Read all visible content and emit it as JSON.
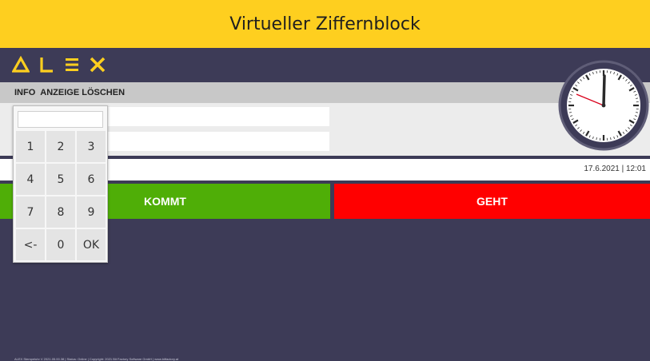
{
  "window": {
    "title": "Virtueller Ziffernblock"
  },
  "brand": {
    "logo_text": "ALEX",
    "logo_color": "#fecf1f"
  },
  "menu": {
    "items": [
      {
        "label": "INFO"
      },
      {
        "label": "ANZEIGE LÖSCHEN"
      }
    ]
  },
  "status": {
    "datetime": "17.6.2021 | 12:01"
  },
  "actions": {
    "kommt_label": "KOMMT",
    "geht_label": "GEHT",
    "kommt_color": "#4fae07",
    "geht_color": "#ff0000"
  },
  "numpad": {
    "display_value": "",
    "keys": [
      "1",
      "2",
      "3",
      "4",
      "5",
      "6",
      "7",
      "8",
      "9",
      "<-",
      "0",
      "OK"
    ]
  },
  "clock": {
    "time": "12:01"
  },
  "footer": {
    "text": "ALEX Stempeluhr V 2021.05.00.38 | Status: Online | Copyright: 2021 Bit Factory Software GmbH | www.bitfactory.at"
  },
  "icons": {
    "clock": "analog-clock-icon"
  },
  "colors": {
    "background": "#3d3b57",
    "titlebar": "#fecf1f",
    "menubar": "#c8c8c8"
  }
}
